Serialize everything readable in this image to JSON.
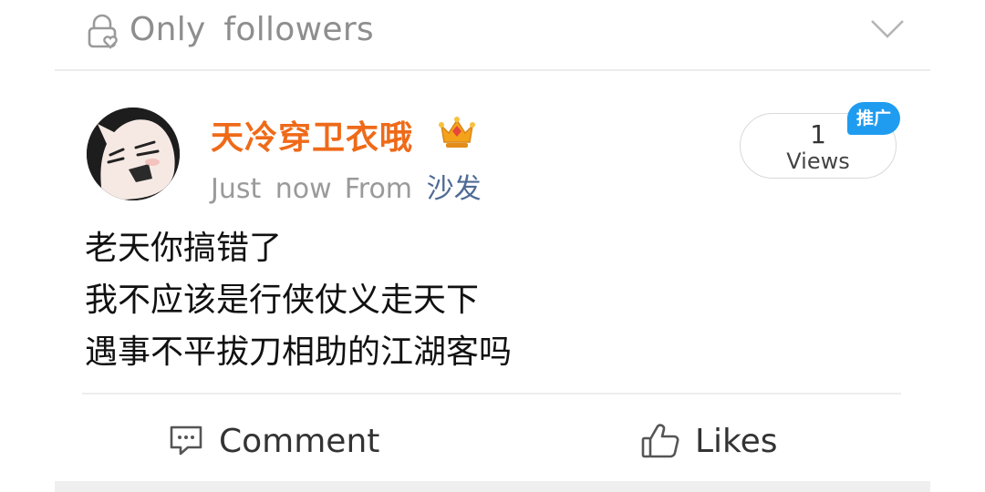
{
  "visibility": {
    "label": "Only followers",
    "icons": {
      "privacy": "lock-heart-icon",
      "expand": "chevron-down-icon"
    }
  },
  "post": {
    "author": {
      "name": "天冷穿卫衣哦",
      "badge_icon": "crown-icon",
      "avatar_icon": "cartoon-face-avatar"
    },
    "meta": {
      "time": "Just now",
      "from_label": "From",
      "source": "沙发"
    },
    "views": {
      "count": "1",
      "label": "Views",
      "badge": "推广"
    },
    "body_lines": [
      "老天你搞错了",
      "我不应该是行侠仗义走天下",
      "遇事不平拔刀相助的江湖客吗"
    ],
    "actions": {
      "comment": {
        "label": "Comment",
        "icon": "comment-icon"
      },
      "likes": {
        "label": "Likes",
        "icon": "thumbs-up-icon"
      }
    }
  },
  "colors": {
    "username": "#ef6a18",
    "source_link": "#4f6b95",
    "promo_badge": "#1f9cf0",
    "secondary_text": "#9a9a9a"
  }
}
